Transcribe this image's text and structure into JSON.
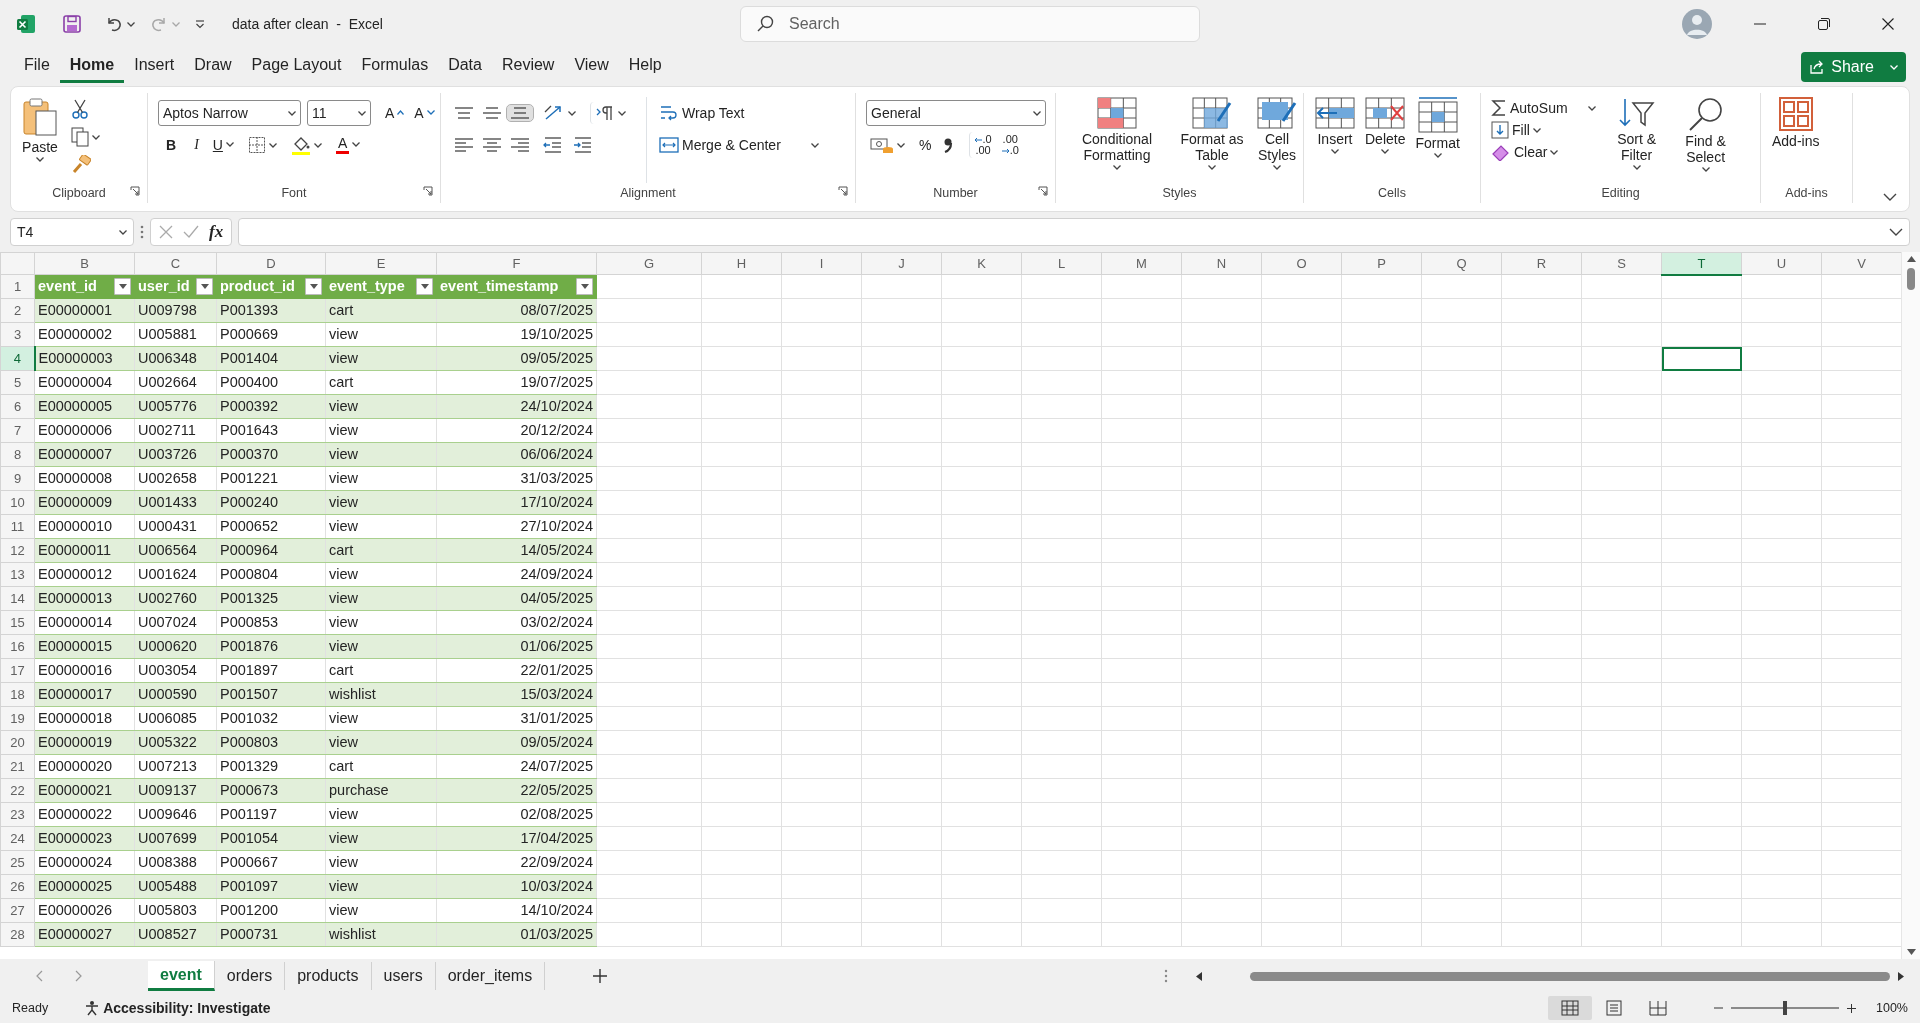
{
  "window": {
    "title": "data after clean  -  Excel",
    "search": {
      "placeholder": "Search"
    }
  },
  "quick_access": {
    "redo": {
      "disabled": true
    }
  },
  "menu": {
    "tabs": [
      {
        "label": "File",
        "selected": false
      },
      {
        "label": "Home",
        "selected": true
      },
      {
        "label": "Insert",
        "selected": false
      },
      {
        "label": "Draw",
        "selected": false
      },
      {
        "label": "Page Layout",
        "selected": false
      },
      {
        "label": "Formulas",
        "selected": false
      },
      {
        "label": "Data",
        "selected": false
      },
      {
        "label": "Review",
        "selected": false
      },
      {
        "label": "View",
        "selected": false
      },
      {
        "label": "Help",
        "selected": false
      }
    ],
    "share": "Share"
  },
  "ribbon": {
    "clipboard": {
      "paste": "Paste",
      "label": "Clipboard"
    },
    "font": {
      "family": "Aptos Narrow",
      "size": "11",
      "grow": "A",
      "shrink": "A",
      "bold": "B",
      "italic": "I",
      "underline": "U",
      "font_color": "A",
      "label": "Font"
    },
    "alignment": {
      "vertical": [
        {
          "kind": "top",
          "selected": false
        },
        {
          "kind": "middle",
          "selected": false
        },
        {
          "kind": "bottom",
          "selected": true
        }
      ],
      "horizontal": [
        {
          "kind": "left",
          "selected": false
        },
        {
          "kind": "center",
          "selected": false
        },
        {
          "kind": "right",
          "selected": false
        }
      ],
      "wrap_text": "Wrap Text",
      "merge": "Merge & Center",
      "label": "Alignment"
    },
    "number": {
      "format": "General",
      "percent": "%",
      "increase_decimal": {
        "top": ".0",
        "bottom": ".00"
      },
      "decrease_decimal": {
        "top": ".00",
        "bottom": ".0"
      },
      "label": "Number"
    },
    "styles": {
      "conditional": "Conditional Formatting",
      "format_table": "Format as Table",
      "cell_styles": "Cell Styles",
      "label": "Styles"
    },
    "cells": {
      "insert": "Insert",
      "delete": "Delete",
      "format": "Format",
      "label": "Cells"
    },
    "editing": {
      "autosum": "AutoSum",
      "fill": "Fill",
      "clear": "Clear",
      "sort": "Sort & Filter",
      "find": "Find & Select",
      "label": "Editing"
    },
    "addins": {
      "button": "Add-ins",
      "label": "Add-ins"
    }
  },
  "formula_bar": {
    "name_box": "T4",
    "fx": "fx"
  },
  "sheet": {
    "columns": [
      {
        "label": "B",
        "selected": false
      },
      {
        "label": "C",
        "selected": false
      },
      {
        "label": "D",
        "selected": false
      },
      {
        "label": "E",
        "selected": false
      },
      {
        "label": "F",
        "selected": false
      },
      {
        "label": "G",
        "selected": false
      },
      {
        "label": "H",
        "selected": false
      },
      {
        "label": "I",
        "selected": false
      },
      {
        "label": "J",
        "selected": false
      },
      {
        "label": "K",
        "selected": false
      },
      {
        "label": "L",
        "selected": false
      },
      {
        "label": "M",
        "selected": false
      },
      {
        "label": "N",
        "selected": false
      },
      {
        "label": "O",
        "selected": false
      },
      {
        "label": "P",
        "selected": false
      },
      {
        "label": "Q",
        "selected": false
      },
      {
        "label": "R",
        "selected": false
      },
      {
        "label": "S",
        "selected": false
      },
      {
        "label": "T",
        "selected": true
      },
      {
        "label": "U",
        "selected": false
      },
      {
        "label": "V",
        "selected": false
      }
    ],
    "rows": [
      {
        "number": "1",
        "kind": "header",
        "selected": false,
        "cells": [
          "event_id",
          "user_id",
          "product_id",
          "event_type",
          "event_timestamp"
        ]
      },
      {
        "number": "2",
        "kind": "data",
        "selected": false,
        "cells": [
          "E00000001",
          "U009798",
          "P001393",
          "cart",
          "08/07/2025"
        ]
      },
      {
        "number": "3",
        "kind": "data",
        "selected": false,
        "cells": [
          "E00000002",
          "U005881",
          "P000669",
          "view",
          "19/10/2025"
        ]
      },
      {
        "number": "4",
        "kind": "data",
        "selected": true,
        "cells": [
          "E00000003",
          "U006348",
          "P001404",
          "view",
          "09/05/2025"
        ]
      },
      {
        "number": "5",
        "kind": "data",
        "selected": false,
        "cells": [
          "E00000004",
          "U002664",
          "P000400",
          "cart",
          "19/07/2025"
        ]
      },
      {
        "number": "6",
        "kind": "data",
        "selected": false,
        "cells": [
          "E00000005",
          "U005776",
          "P000392",
          "view",
          "24/10/2024"
        ]
      },
      {
        "number": "7",
        "kind": "data",
        "selected": false,
        "cells": [
          "E00000006",
          "U002711",
          "P001643",
          "view",
          "20/12/2024"
        ]
      },
      {
        "number": "8",
        "kind": "data",
        "selected": false,
        "cells": [
          "E00000007",
          "U003726",
          "P000370",
          "view",
          "06/06/2024"
        ]
      },
      {
        "number": "9",
        "kind": "data",
        "selected": false,
        "cells": [
          "E00000008",
          "U002658",
          "P001221",
          "view",
          "31/03/2025"
        ]
      },
      {
        "number": "10",
        "kind": "data",
        "selected": false,
        "cells": [
          "E00000009",
          "U001433",
          "P000240",
          "view",
          "17/10/2024"
        ]
      },
      {
        "number": "11",
        "kind": "data",
        "selected": false,
        "cells": [
          "E00000010",
          "U000431",
          "P000652",
          "view",
          "27/10/2024"
        ]
      },
      {
        "number": "12",
        "kind": "data",
        "selected": false,
        "cells": [
          "E00000011",
          "U006564",
          "P000964",
          "cart",
          "14/05/2024"
        ]
      },
      {
        "number": "13",
        "kind": "data",
        "selected": false,
        "cells": [
          "E00000012",
          "U001624",
          "P000804",
          "view",
          "24/09/2024"
        ]
      },
      {
        "number": "14",
        "kind": "data",
        "selected": false,
        "cells": [
          "E00000013",
          "U002760",
          "P001325",
          "view",
          "04/05/2025"
        ]
      },
      {
        "number": "15",
        "kind": "data",
        "selected": false,
        "cells": [
          "E00000014",
          "U007024",
          "P000853",
          "view",
          "03/02/2024"
        ]
      },
      {
        "number": "16",
        "kind": "data",
        "selected": false,
        "cells": [
          "E00000015",
          "U000620",
          "P001876",
          "view",
          "01/06/2025"
        ]
      },
      {
        "number": "17",
        "kind": "data",
        "selected": false,
        "cells": [
          "E00000016",
          "U003054",
          "P001897",
          "cart",
          "22/01/2025"
        ]
      },
      {
        "number": "18",
        "kind": "data",
        "selected": false,
        "cells": [
          "E00000017",
          "U000590",
          "P001507",
          "wishlist",
          "15/03/2024"
        ]
      },
      {
        "number": "19",
        "kind": "data",
        "selected": false,
        "cells": [
          "E00000018",
          "U006085",
          "P001032",
          "view",
          "31/01/2025"
        ]
      },
      {
        "number": "20",
        "kind": "data",
        "selected": false,
        "cells": [
          "E00000019",
          "U005322",
          "P000803",
          "view",
          "09/05/2024"
        ]
      },
      {
        "number": "21",
        "kind": "data",
        "selected": false,
        "cells": [
          "E00000020",
          "U007213",
          "P001329",
          "cart",
          "24/07/2025"
        ]
      },
      {
        "number": "22",
        "kind": "data",
        "selected": false,
        "cells": [
          "E00000021",
          "U009137",
          "P000673",
          "purchase",
          "22/05/2025"
        ]
      },
      {
        "number": "23",
        "kind": "data",
        "selected": false,
        "cells": [
          "E00000022",
          "U009646",
          "P001197",
          "view",
          "02/08/2025"
        ]
      },
      {
        "number": "24",
        "kind": "data",
        "selected": false,
        "cells": [
          "E00000023",
          "U007699",
          "P001054",
          "view",
          "17/04/2025"
        ]
      },
      {
        "number": "25",
        "kind": "data",
        "selected": false,
        "cells": [
          "E00000024",
          "U008388",
          "P000667",
          "view",
          "22/09/2024"
        ]
      },
      {
        "number": "26",
        "kind": "data",
        "selected": false,
        "cells": [
          "E00000025",
          "U005488",
          "P001097",
          "view",
          "10/03/2024"
        ]
      },
      {
        "number": "27",
        "kind": "data",
        "selected": false,
        "cells": [
          "E00000026",
          "U005803",
          "P001200",
          "view",
          "14/10/2024"
        ]
      },
      {
        "number": "28",
        "kind": "data",
        "selected": false,
        "cells": [
          "E00000027",
          "U008527",
          "P000731",
          "wishlist",
          "01/03/2025"
        ]
      }
    ]
  },
  "sheet_tabs": [
    {
      "label": "event",
      "selected": true
    },
    {
      "label": "orders",
      "selected": false
    },
    {
      "label": "products",
      "selected": false
    },
    {
      "label": "users",
      "selected": false
    },
    {
      "label": "order_items",
      "selected": false
    }
  ],
  "status_bar": {
    "ready": "Ready",
    "accessibility": "Accessibility: Investigate",
    "views": [
      {
        "kind": "normal",
        "selected": true
      },
      {
        "kind": "page_layout",
        "selected": false
      },
      {
        "kind": "page_break",
        "selected": false
      }
    ],
    "zoom": {
      "level": 0.5,
      "reading": "100%"
    }
  }
}
